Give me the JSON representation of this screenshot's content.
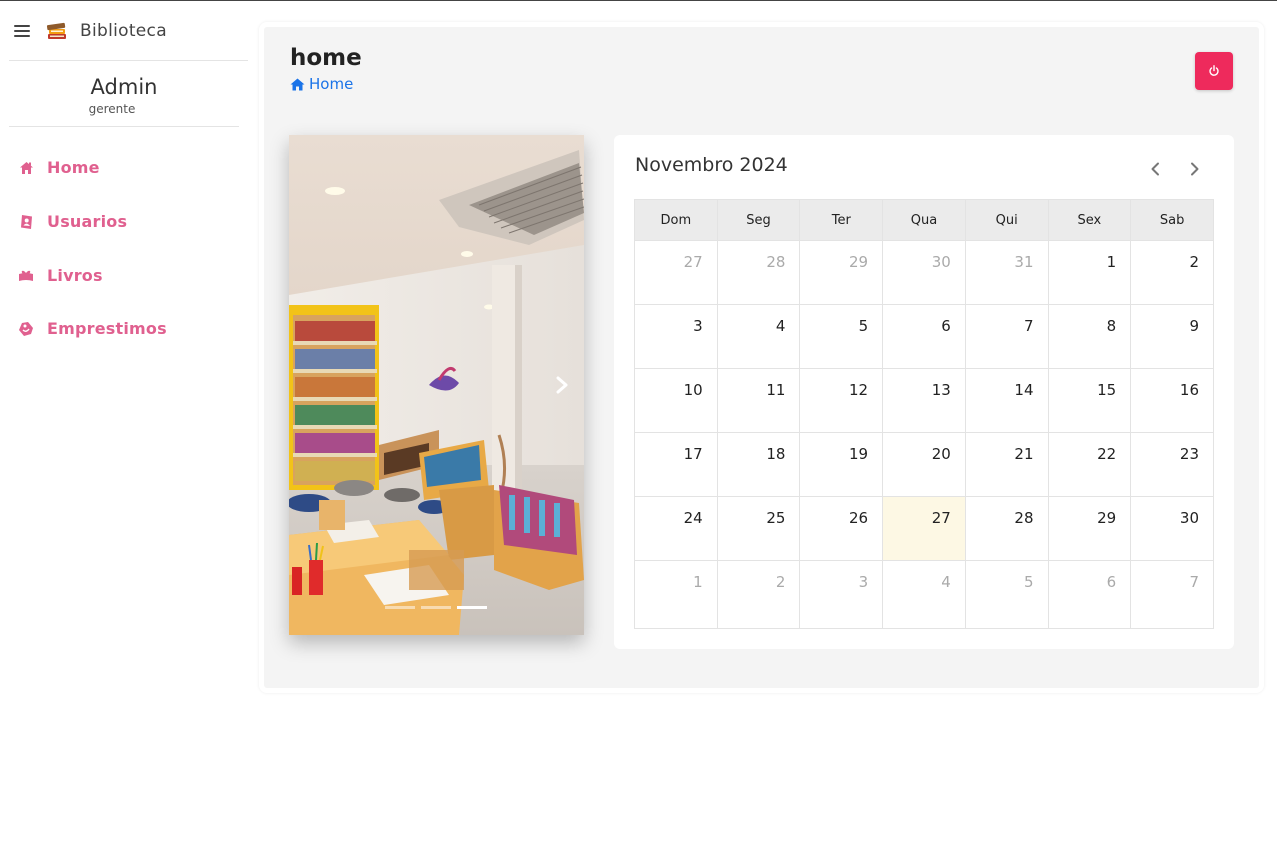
{
  "sidebar": {
    "brand": "Biblioteca",
    "user_name": "Admin",
    "user_role": "gerente",
    "items": [
      {
        "label": "Home",
        "icon": "home-icon"
      },
      {
        "label": "Usuarios",
        "icon": "user-book-icon"
      },
      {
        "label": "Livros",
        "icon": "book-heart-icon"
      },
      {
        "label": "Emprestimos",
        "icon": "tag-icon"
      }
    ],
    "accent_color": "#e0608f"
  },
  "header": {
    "title": "home",
    "breadcrumb": "Home",
    "breadcrumb_color": "#1a73e8",
    "logout_color": "#ee2a5c"
  },
  "carousel": {
    "slides": 3,
    "active_slide": 3
  },
  "calendar": {
    "title": "Novembro 2024",
    "weekdays": [
      "Dom",
      "Seg",
      "Ter",
      "Qua",
      "Qui",
      "Sex",
      "Sab"
    ],
    "weeks": [
      [
        {
          "d": "27",
          "m": true
        },
        {
          "d": "28",
          "m": true
        },
        {
          "d": "29",
          "m": true
        },
        {
          "d": "30",
          "m": true
        },
        {
          "d": "31",
          "m": true
        },
        {
          "d": "1"
        },
        {
          "d": "2"
        }
      ],
      [
        {
          "d": "3"
        },
        {
          "d": "4"
        },
        {
          "d": "5"
        },
        {
          "d": "6"
        },
        {
          "d": "7"
        },
        {
          "d": "8"
        },
        {
          "d": "9"
        }
      ],
      [
        {
          "d": "10"
        },
        {
          "d": "11"
        },
        {
          "d": "12"
        },
        {
          "d": "13"
        },
        {
          "d": "14"
        },
        {
          "d": "15"
        },
        {
          "d": "16"
        }
      ],
      [
        {
          "d": "17"
        },
        {
          "d": "18"
        },
        {
          "d": "19"
        },
        {
          "d": "20"
        },
        {
          "d": "21"
        },
        {
          "d": "22"
        },
        {
          "d": "23"
        }
      ],
      [
        {
          "d": "24"
        },
        {
          "d": "25"
        },
        {
          "d": "26"
        },
        {
          "d": "27",
          "today": true
        },
        {
          "d": "28"
        },
        {
          "d": "29"
        },
        {
          "d": "30"
        }
      ],
      [
        {
          "d": "1",
          "m": true
        },
        {
          "d": "2",
          "m": true
        },
        {
          "d": "3",
          "m": true
        },
        {
          "d": "4",
          "m": true
        },
        {
          "d": "5",
          "m": true
        },
        {
          "d": "6",
          "m": true
        },
        {
          "d": "7",
          "m": true
        }
      ]
    ],
    "today_color": "#fdf8e4"
  }
}
